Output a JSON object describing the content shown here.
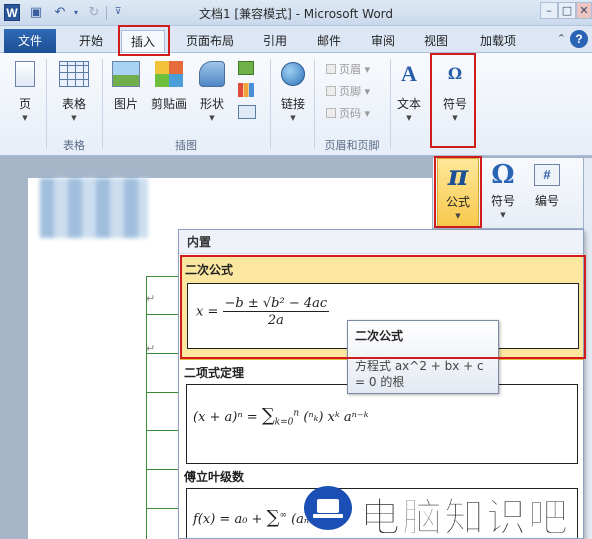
{
  "window": {
    "title": "文档1 [兼容模式] - Microsoft Word",
    "app_icon": "W",
    "undo_icon": "undo-icon",
    "redo_icon": "redo-icon",
    "save_icon": "save-icon"
  },
  "tabs": {
    "file": "文件",
    "items": [
      "开始",
      "插入",
      "页面布局",
      "引用",
      "邮件",
      "审阅",
      "视图",
      "加载项"
    ],
    "active": "插入"
  },
  "ribbon": {
    "page": "页",
    "table": "表格",
    "table_group": "表格",
    "picture": "图片",
    "clipart": "剪贴画",
    "shapes": "形状",
    "illustrations_group": "插图",
    "link": "链接",
    "header": "页眉",
    "footer": "页脚",
    "page_number": "页码",
    "header_footer_group": "页眉和页脚",
    "text": "文本",
    "symbol": "符号"
  },
  "popup": {
    "formula": "公式",
    "symbol": "符号",
    "numbering": "编号",
    "pi_glyph": "π",
    "omega_glyph": "Ω",
    "hash_glyph": "#"
  },
  "gallery": {
    "header": "内置",
    "entries": [
      {
        "title": "二次公式"
      },
      {
        "title": "二项式定理"
      },
      {
        "title": "傅立叶级数"
      }
    ]
  },
  "tooltip": {
    "title": "二次公式",
    "description": "方程式 ax^2 + bx + c = 0 的根"
  },
  "watermark": {
    "text": "电脑知识吧"
  },
  "colors": {
    "highlight": "#d11c1c",
    "file_tab": "#2b62ad",
    "formula_button": "#f9d36a",
    "selected_entry": "#fbe7a0"
  }
}
